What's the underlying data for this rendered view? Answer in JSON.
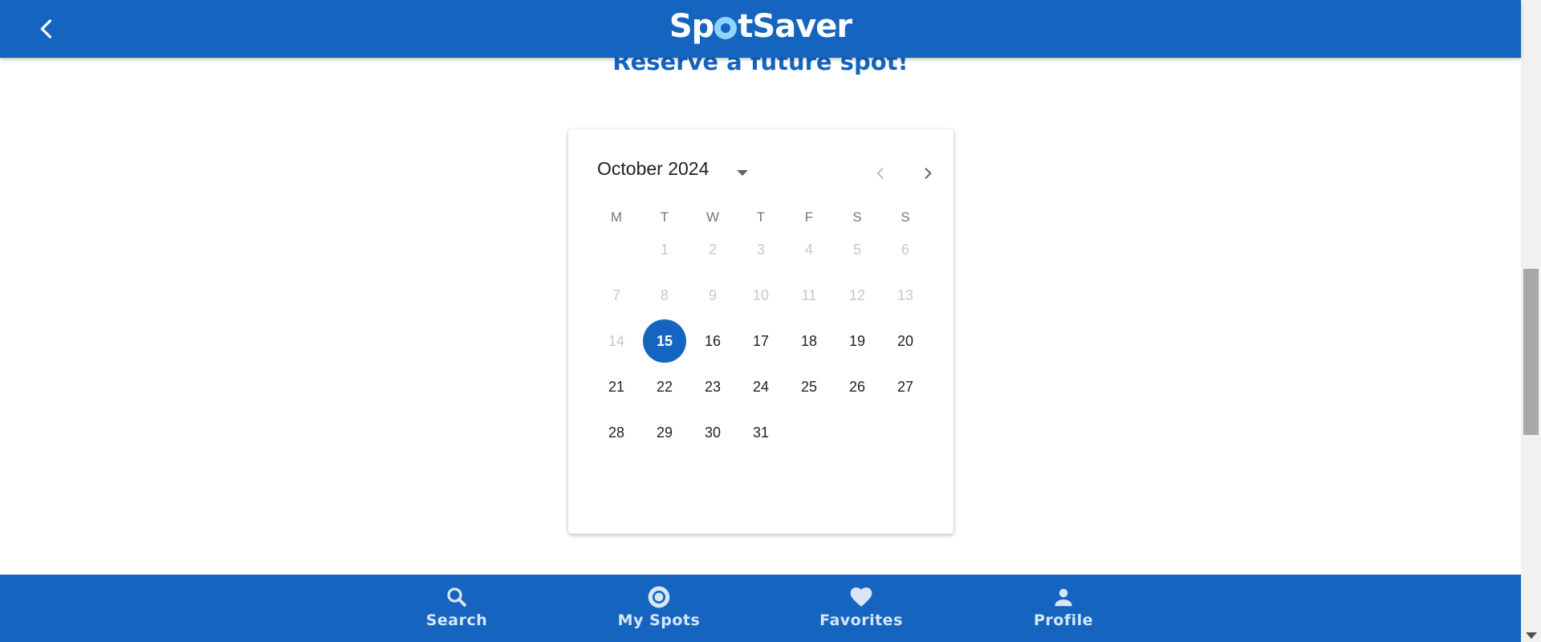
{
  "app": {
    "logo_text_before": "Sp",
    "logo_text_after": "tSaver",
    "brand_color": "#1565c0"
  },
  "header": {
    "back_icon": "chevron-left-icon"
  },
  "heading": "Reserve a future spot!",
  "calendar": {
    "month_label": "October 2024",
    "weekdays": [
      "M",
      "T",
      "W",
      "T",
      "F",
      "S",
      "S"
    ],
    "first_weekday_offset": 1,
    "selected_day": 15,
    "disabled_days": [
      1,
      2,
      3,
      4,
      5,
      6,
      7,
      8,
      9,
      10,
      11,
      12,
      13,
      14
    ],
    "days_in_month": 31,
    "day_labels": [
      "1",
      "2",
      "3",
      "4",
      "5",
      "6",
      "7",
      "8",
      "9",
      "10",
      "11",
      "12",
      "13",
      "14",
      "15",
      "16",
      "17",
      "18",
      "19",
      "20",
      "21",
      "22",
      "23",
      "24",
      "25",
      "26",
      "27",
      "28",
      "29",
      "30",
      "31"
    ]
  },
  "bottom_nav": {
    "items": [
      {
        "label": "Search",
        "icon": "search-icon"
      },
      {
        "label": "My Spots",
        "icon": "target-icon"
      },
      {
        "label": "Favorites",
        "icon": "heart-icon"
      },
      {
        "label": "Profile",
        "icon": "person-icon"
      }
    ]
  }
}
